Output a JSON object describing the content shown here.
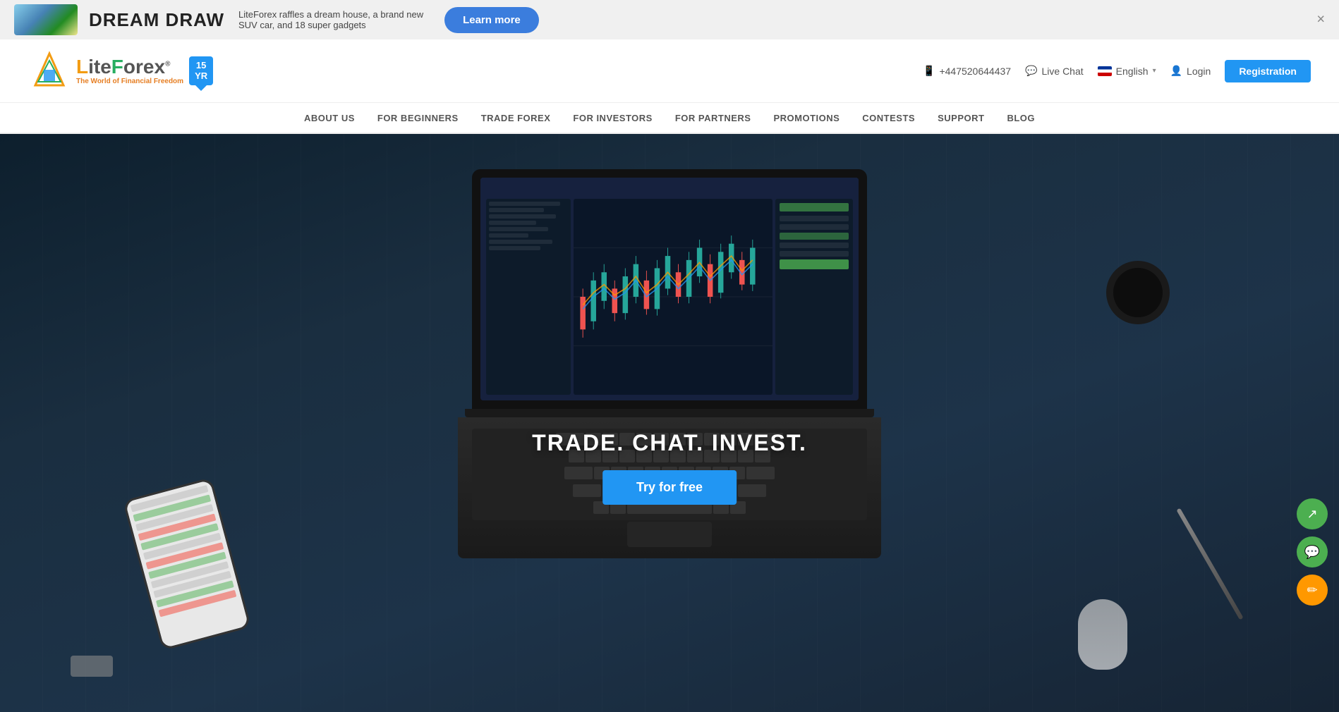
{
  "banner": {
    "title": "DREAM DRAW",
    "description_line1": "LiteForex raffles a dream house, a brand new",
    "description_line2": "SUV car, and 18 super gadgets",
    "learn_more_label": "Learn more",
    "close_label": "×"
  },
  "header": {
    "logo_name": "LiteForex",
    "logo_tagline": "The World of Financial Freedom",
    "badge_line1": "1 5",
    "badge_line2": "Y R",
    "phone": "+447520644437",
    "live_chat_label": "Live Chat",
    "language": "English",
    "login_label": "Login",
    "register_label": "Registration"
  },
  "nav": {
    "items": [
      {
        "label": "ABOUT US",
        "active": false
      },
      {
        "label": "FOR BEGINNERS",
        "active": false
      },
      {
        "label": "TRADE FOREX",
        "active": false
      },
      {
        "label": "FOR INVESTORS",
        "active": false
      },
      {
        "label": "FOR PARTNERS",
        "active": false
      },
      {
        "label": "PROMOTIONS",
        "active": false
      },
      {
        "label": "CONTESTS",
        "active": false
      },
      {
        "label": "SUPPORT",
        "active": false
      },
      {
        "label": "BLOG",
        "active": false
      }
    ]
  },
  "hero": {
    "title": "TRADE. CHAT. INVEST.",
    "cta_label": "Try for free"
  },
  "fab": {
    "share_icon": "↗",
    "chat_icon": "💬",
    "edit_icon": "✏"
  }
}
